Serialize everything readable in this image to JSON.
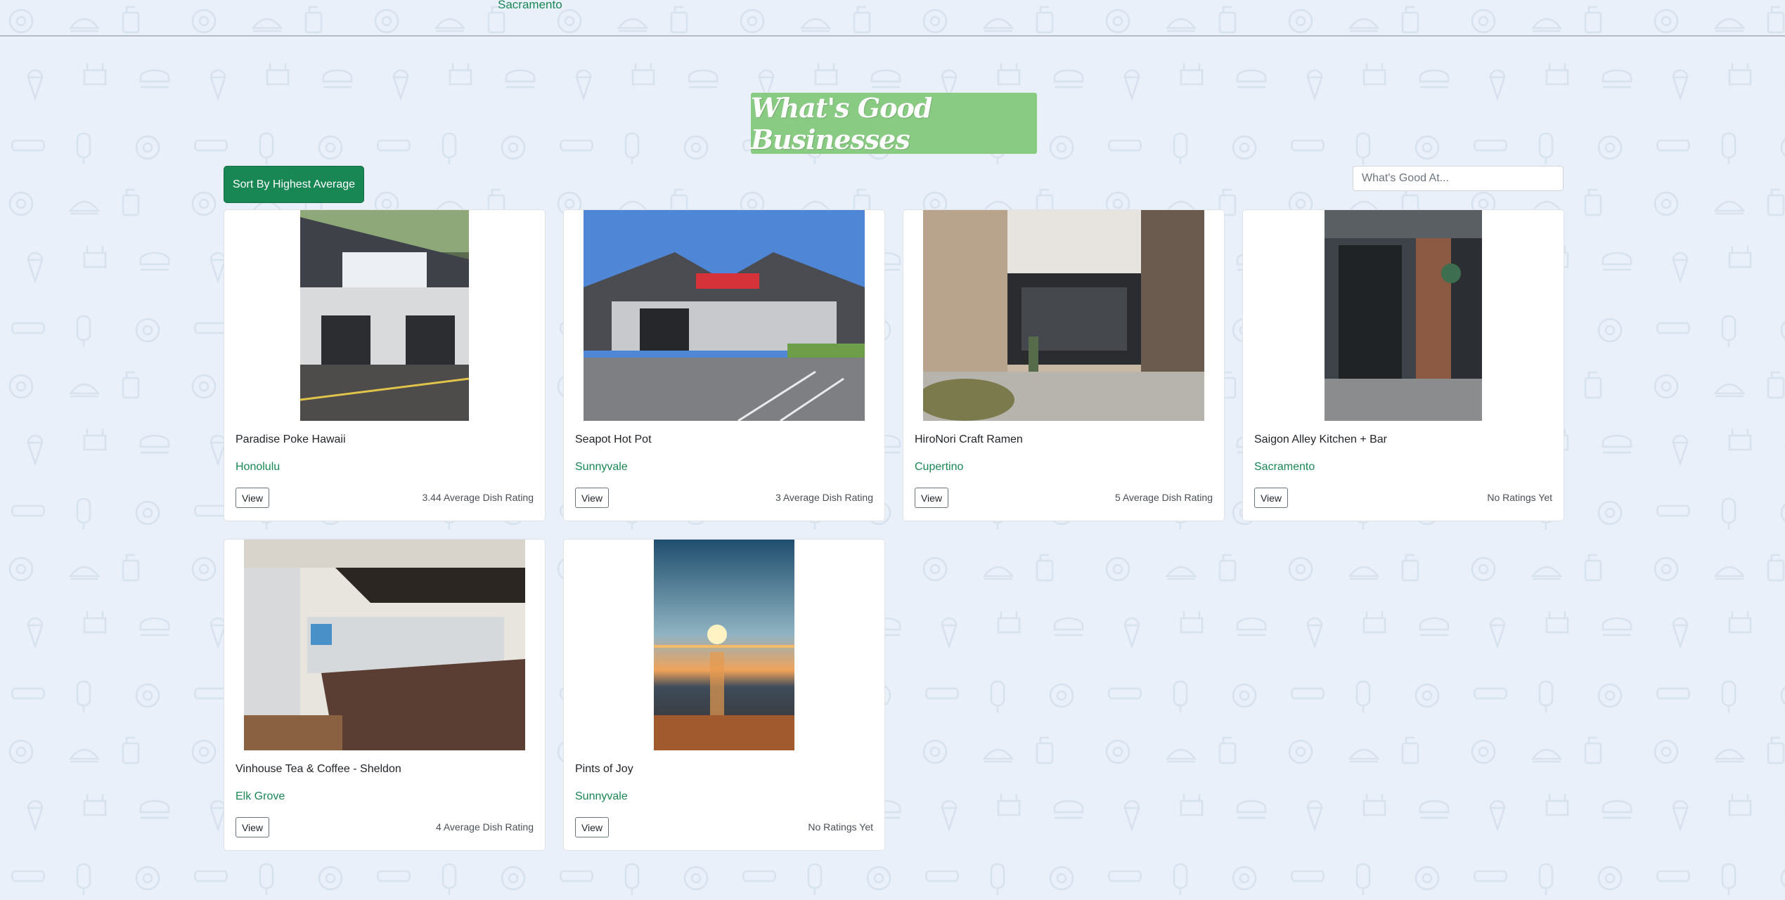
{
  "topbar": {
    "city_fragment": "Sacramento"
  },
  "title": "What's Good Businesses",
  "sort_button": "Sort By Highest Average",
  "search": {
    "placeholder": "What's Good At...",
    "value": ""
  },
  "businesses": [
    {
      "name": "Paradise Poke Hawaii",
      "city": "Honolulu",
      "view_label": "View",
      "rating": "3.44 Average Dish Rating",
      "photo": "storefront"
    },
    {
      "name": "Seapot Hot Pot",
      "city": "Sunnyvale",
      "view_label": "View",
      "rating": "3 Average Dish Rating",
      "photo": "storefront"
    },
    {
      "name": "HiroNori Craft Ramen",
      "city": "Cupertino",
      "view_label": "View",
      "rating": "5 Average Dish Rating",
      "photo": "storefront"
    },
    {
      "name": "Saigon Alley Kitchen + Bar",
      "city": "Sacramento",
      "view_label": "View",
      "rating": "No Ratings Yet",
      "photo": "storefront"
    },
    {
      "name": "Vinhouse Tea & Coffee - Sheldon",
      "city": "Elk Grove",
      "view_label": "View",
      "rating": "4 Average Dish Rating",
      "photo": "interior"
    },
    {
      "name": "Pints of Joy",
      "city": "Sunnyvale",
      "view_label": "View",
      "rating": "No Ratings Yet",
      "photo": "sunset-beach"
    }
  ],
  "colors": {
    "background": "#e9f0f9",
    "title_bg": "#8acb83",
    "primary": "#198754"
  }
}
